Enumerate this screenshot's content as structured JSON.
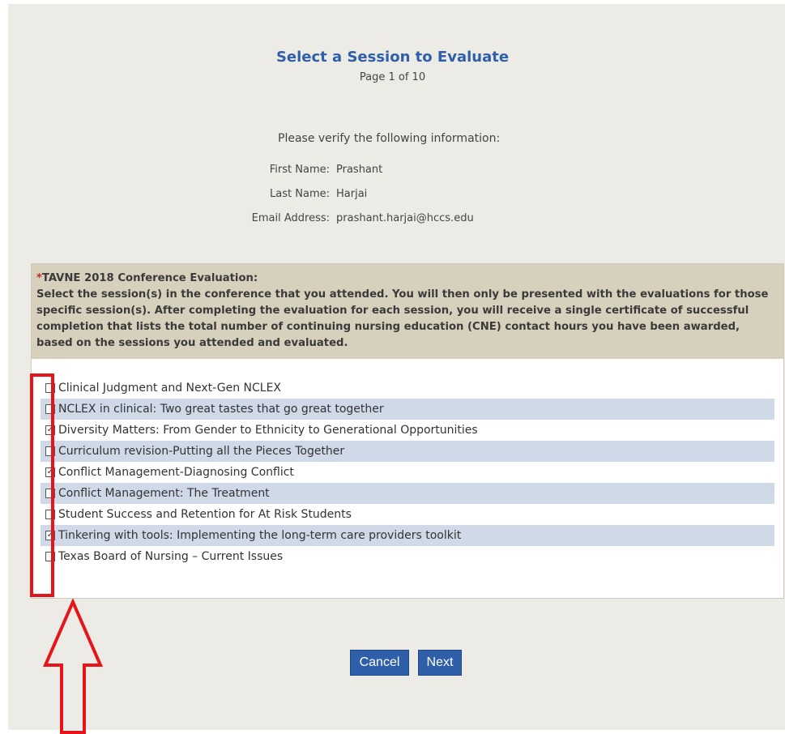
{
  "header": {
    "title": "Select a Session to Evaluate",
    "page_info": "Page 1 of 10"
  },
  "verify": {
    "prompt": "Please verify the following information:",
    "first_name_label": "First Name:",
    "first_name_value": "Prashant",
    "last_name_label": "Last Name:",
    "last_name_value": "Harjai",
    "email_label": "Email Address:",
    "email_value": "prashant.harjai@hccs.edu"
  },
  "evaluation": {
    "required_marker": "*",
    "heading": "TAVNE 2018 Conference Evaluation:",
    "instructions": "Select the session(s) in the conference that you attended. You will then only be presented with the evaluations for those specific session(s). After completing the evaluation for each session, you will receive a single certificate of successful completion that lists the total number of continuing nursing education (CNE) contact hours you have been awarded, based on the sessions you attended and evaluated.",
    "sessions": [
      {
        "label": "Clinical Judgment and Next-Gen NCLEX",
        "checked": false
      },
      {
        "label": "NCLEX in clinical: Two great tastes that go great together",
        "checked": false
      },
      {
        "label": "Diversity Matters: From Gender to Ethnicity to Generational Opportunities",
        "checked": true
      },
      {
        "label": "Curriculum revision-Putting all the Pieces Together",
        "checked": false
      },
      {
        "label": "Conflict Management-Diagnosing Conflict",
        "checked": true
      },
      {
        "label": "Conflict Management: The Treatment",
        "checked": false
      },
      {
        "label": "Student Success and Retention for At Risk Students",
        "checked": false
      },
      {
        "label": "Tinkering with tools: Implementing the long-term care providers toolkit",
        "checked": true
      },
      {
        "label": "Texas Board of Nursing – Current Issues",
        "checked": false
      }
    ]
  },
  "actions": {
    "cancel_label": "Cancel",
    "next_label": "Next"
  },
  "colors": {
    "accent": "#2e5fa8",
    "annotation": "#e8141c",
    "row_alt": "#cfd9e8",
    "header_bg": "#d6d0bc"
  }
}
